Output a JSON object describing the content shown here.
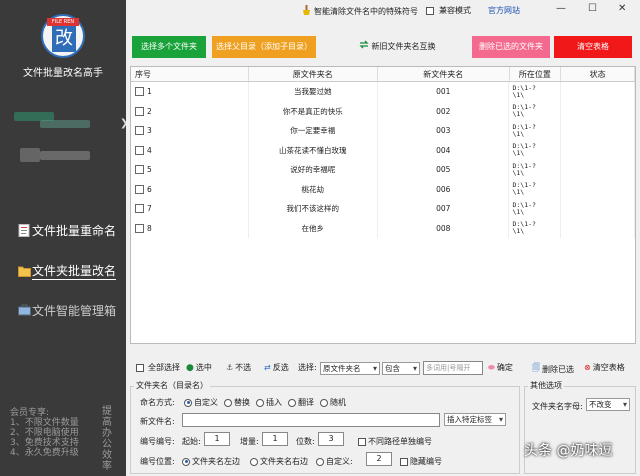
{
  "sidebar": {
    "logo_tag": "FILE REN",
    "logo_char": "改",
    "app_title": "文件批量改名高手",
    "nav": [
      {
        "label": "文件批量重命名"
      },
      {
        "label": "文件夹批量改名"
      },
      {
        "label": "文件智能管理箱"
      }
    ],
    "footer_lines": [
      "会员专享:",
      "1、不限文件数量",
      "2、不限电脑使用",
      "3、免费技术支持",
      "4、永久免费升级"
    ],
    "footer_vertical": "提高办公效率"
  },
  "topbar": {
    "smart_clear": "智能清除文件名中的特殊符号",
    "compat_mode": "兼容模式",
    "official_site": "官方网站"
  },
  "buttons": {
    "select_multi": "选择多个文件夹",
    "select_sub": "选择父目录（添加子目录）",
    "swap": "新旧文件夹名互换",
    "delete_selected": "删除已选的文件夹",
    "clear_table": "清空表格"
  },
  "colors": {
    "green": "#1aa33a",
    "orange": "#f0a020",
    "pink": "#f46a8e",
    "red": "#f01818",
    "sidebar": "#3a3a3a"
  },
  "table": {
    "headers": [
      "序号",
      "原文件夹名",
      "新文件夹名",
      "所在位置",
      "状态"
    ],
    "rows": [
      {
        "no": "1",
        "orig": "当我娶过她",
        "new": "001",
        "loc": "D:\\1-?\n\\1\\"
      },
      {
        "no": "2",
        "orig": "你不是真正的快乐",
        "new": "002",
        "loc": "D:\\1-?\n\\1\\"
      },
      {
        "no": "3",
        "orig": "你一定要幸福",
        "new": "003",
        "loc": "D:\\1-?\n\\1\\"
      },
      {
        "no": "4",
        "orig": "山茶花读不懂白玫瑰",
        "new": "004",
        "loc": "D:\\1-?\n\\1\\"
      },
      {
        "no": "5",
        "orig": "说好的幸福呢",
        "new": "005",
        "loc": "D:\\1-?\n\\1\\"
      },
      {
        "no": "6",
        "orig": "桃花劫",
        "new": "006",
        "loc": "D:\\1-?\n\\1\\"
      },
      {
        "no": "7",
        "orig": "我们不该这样的",
        "new": "007",
        "loc": "D:\\1-?\n\\1\\"
      },
      {
        "no": "8",
        "orig": "在他乡",
        "new": "008",
        "loc": "D:\\1-?\n\\1\\"
      }
    ]
  },
  "selectbar": {
    "select_all": "全部选择",
    "select": "选中",
    "unselect": "不选",
    "invert": "反选",
    "choose": "选择:",
    "field_value": "原文件夹名",
    "match_value": "包含",
    "pattern_placeholder": "多词用|号隔开",
    "confirm": "确定",
    "delete_selected": "删除已选",
    "clear_table": "清空表格"
  },
  "naming": {
    "group_label": "文件夹名（目录名）",
    "mode_label": "命名方式:",
    "modes": [
      "自定义",
      "替换",
      "插入",
      "翻译",
      "随机"
    ],
    "new_name_label": "新文件名:",
    "insert_tag": "插入特定标签",
    "numbering_label": "编号编号:",
    "start_label": "起始:",
    "start_value": "1",
    "step_label": "增量:",
    "step_value": "1",
    "digits_label": "位数:",
    "digits_value": "3",
    "separate_label": "不同路径单独编号",
    "position_label": "编号位置:",
    "pos_left": "文件夹名左边",
    "pos_right": "文件夹名右边",
    "pos_custom": "自定义:",
    "pos_custom_value": "2",
    "hide_label": "隐藏编号"
  },
  "other": {
    "group_label": "其他选项",
    "case_label": "文件夹名字母:",
    "case_value": "不改变"
  },
  "watermark": "头条 @奶味逗"
}
